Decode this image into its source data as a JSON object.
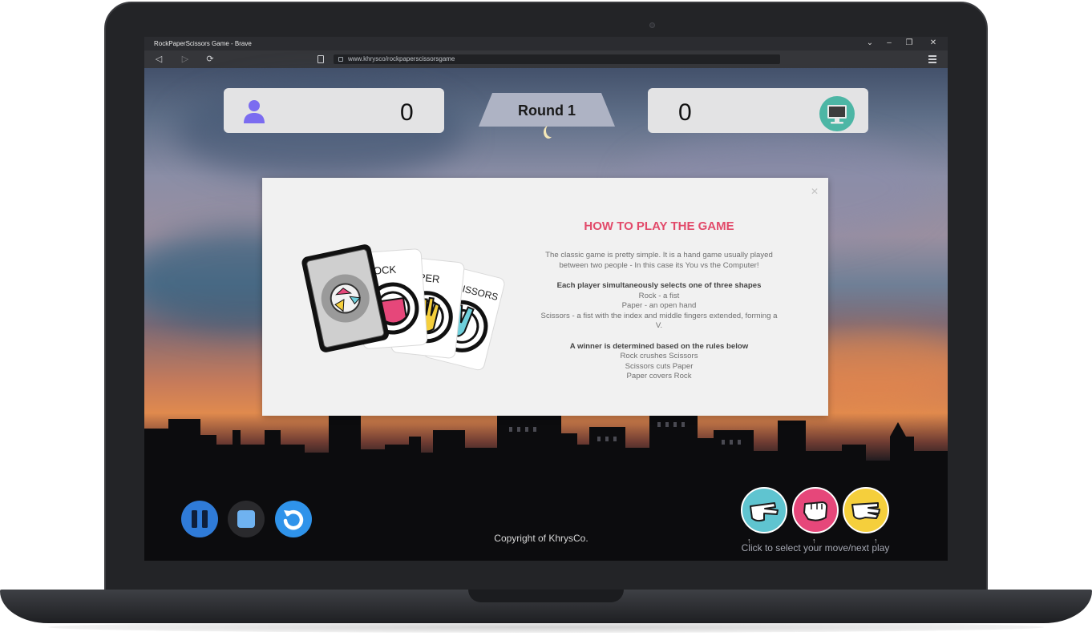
{
  "window": {
    "title": "RockPaperScissors Game - Brave",
    "url": "www.khrysco/rockpaperscissorsgame"
  },
  "game": {
    "player_score": "0",
    "computer_score": "0",
    "round_label": "Round 1"
  },
  "modal": {
    "heading": "HOW TO PLAY THE GAME",
    "intro": "The classic game is pretty simple. It is a hand game usually played between two people - In this case its You vs the Computer!",
    "shapes_heading": "Each player simultaneously selects one of three shapes",
    "shapes": [
      "Rock - a fist",
      "Paper - an open hand",
      "Scissors - a fist with the index and middle fingers extended, forming a V."
    ],
    "rules_heading": "A winner is determined based on the rules below",
    "rules": [
      "Rock crushes Scissors",
      "Scissors cuts Paper",
      "Paper covers Rock"
    ],
    "cards": [
      "ROCK",
      "PAPER",
      "SCISSORS"
    ]
  },
  "footer": {
    "copyright": "Copyright  of KhrysCo.",
    "hint": "Click to select your move/next play",
    "arrow": "↑"
  },
  "colors": {
    "pause": "#2f7bd8",
    "stop": "#2a2a2d",
    "restart": "#2f93ea",
    "scissors_move": "#5fc4d0",
    "rock_move": "#e6477a",
    "paper_move": "#f5cf3c",
    "heading": "#e24a6a"
  },
  "icons": {
    "player": "user-icon",
    "computer": "monitor-icon",
    "pause": "pause-icon",
    "stop": "stop-icon",
    "restart": "restart-icon",
    "scissors": "scissors-hand-icon",
    "rock": "rock-fist-icon",
    "paper": "paper-hand-icon"
  }
}
